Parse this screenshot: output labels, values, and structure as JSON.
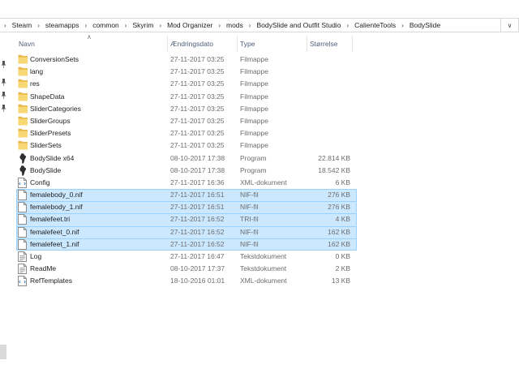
{
  "breadcrumb": [
    "Steam",
    "steamapps",
    "common",
    "Skyrim",
    "Mod Organizer",
    "mods",
    "BodySlide and Outfit Studio",
    "CalienteTools",
    "BodySlide"
  ],
  "columns": {
    "name": "Navn",
    "date": "Ændringsdato",
    "type": "Type",
    "size": "Størrelse"
  },
  "files": [
    {
      "name": "ConversionSets",
      "date": "27-11-2017 03:25",
      "type": "Filmappe",
      "size": "",
      "icon": "folder-icon",
      "selected": false
    },
    {
      "name": "lang",
      "date": "27-11-2017 03:25",
      "type": "Filmappe",
      "size": "",
      "icon": "folder-icon",
      "selected": false
    },
    {
      "name": "res",
      "date": "27-11-2017 03:25",
      "type": "Filmappe",
      "size": "",
      "icon": "folder-icon",
      "selected": false
    },
    {
      "name": "ShapeData",
      "date": "27-11-2017 03:25",
      "type": "Filmappe",
      "size": "",
      "icon": "folder-icon",
      "selected": false
    },
    {
      "name": "SliderCategories",
      "date": "27-11-2017 03:25",
      "type": "Filmappe",
      "size": "",
      "icon": "folder-icon",
      "selected": false
    },
    {
      "name": "SliderGroups",
      "date": "27-11-2017 03:25",
      "type": "Filmappe",
      "size": "",
      "icon": "folder-icon",
      "selected": false
    },
    {
      "name": "SliderPresets",
      "date": "27-11-2017 03:25",
      "type": "Filmappe",
      "size": "",
      "icon": "folder-icon",
      "selected": false
    },
    {
      "name": "SliderSets",
      "date": "27-11-2017 03:25",
      "type": "Filmappe",
      "size": "",
      "icon": "folder-icon",
      "selected": false
    },
    {
      "name": "BodySlide x64",
      "date": "08-10-2017 17:38",
      "type": "Program",
      "size": "22.814 KB",
      "icon": "bodyslide-app-icon",
      "selected": false
    },
    {
      "name": "BodySlide",
      "date": "08-10-2017 17:38",
      "type": "Program",
      "size": "18.542 KB",
      "icon": "bodyslide-app-icon",
      "selected": false
    },
    {
      "name": "Config",
      "date": "27-11-2017 16:36",
      "type": "XML-dokument",
      "size": "6 KB",
      "icon": "xml-document-icon",
      "selected": false
    },
    {
      "name": "femalebody_0.nif",
      "date": "27-11-2017 16:51",
      "type": "NIF-fil",
      "size": "276 KB",
      "icon": "file-icon",
      "selected": true
    },
    {
      "name": "femalebody_1.nif",
      "date": "27-11-2017 16:51",
      "type": "NIF-fil",
      "size": "276 KB",
      "icon": "file-icon",
      "selected": true
    },
    {
      "name": "femalefeet.tri",
      "date": "27-11-2017 16:52",
      "type": "TRI-fil",
      "size": "4 KB",
      "icon": "file-icon",
      "selected": true
    },
    {
      "name": "femalefeet_0.nif",
      "date": "27-11-2017 16:52",
      "type": "NIF-fil",
      "size": "162 KB",
      "icon": "file-icon",
      "selected": true
    },
    {
      "name": "femalefeet_1.nif",
      "date": "27-11-2017 16:52",
      "type": "NIF-fil",
      "size": "162 KB",
      "icon": "file-icon",
      "selected": true
    },
    {
      "name": "Log",
      "date": "27-11-2017 16:47",
      "type": "Tekstdokument",
      "size": "0 KB",
      "icon": "text-document-icon",
      "selected": false
    },
    {
      "name": "ReadMe",
      "date": "08-10-2017 17:37",
      "type": "Tekstdokument",
      "size": "2 KB",
      "icon": "text-document-icon",
      "selected": false
    },
    {
      "name": "RefTemplates",
      "date": "18-10-2016 01:01",
      "type": "XML-dokument",
      "size": "13 KB",
      "icon": "xml-document-icon",
      "selected": false
    }
  ],
  "colors": {
    "selection_bg": "#cce8ff",
    "selection_border": "#99d1ff",
    "folder": "#f8d775",
    "header_text": "#4c607a"
  }
}
